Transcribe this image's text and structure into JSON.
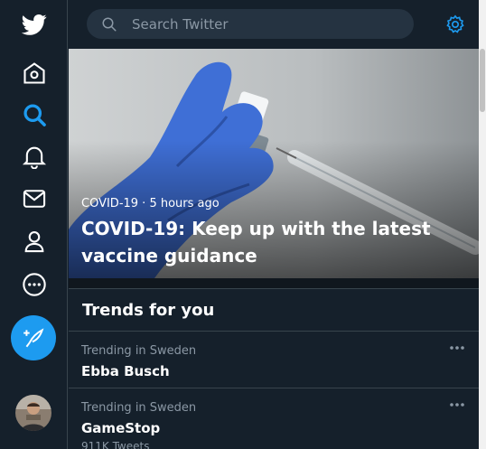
{
  "search": {
    "placeholder": "Search Twitter"
  },
  "hero": {
    "meta": "COVID-19 · 5 hours ago",
    "title": "COVID-19: Keep up with the latest vaccine guidance"
  },
  "trends": {
    "heading": "Trends for you",
    "items": [
      {
        "context": "Trending in Sweden",
        "name": "Ebba Busch",
        "count": ""
      },
      {
        "context": "Trending in Sweden",
        "name": "GameStop",
        "count": "911K Tweets"
      }
    ]
  },
  "icons": {
    "logo": "twitter-bird-icon",
    "home": "home-icon",
    "explore": "search-icon",
    "notifications": "bell-icon",
    "messages": "mail-icon",
    "profile": "person-icon",
    "more": "more-circle-icon",
    "compose": "compose-icon",
    "settings": "gear-icon"
  },
  "colors": {
    "accent": "#1d9bf0",
    "background": "#15202b",
    "border": "#38444d",
    "muted": "#8b98a5"
  }
}
